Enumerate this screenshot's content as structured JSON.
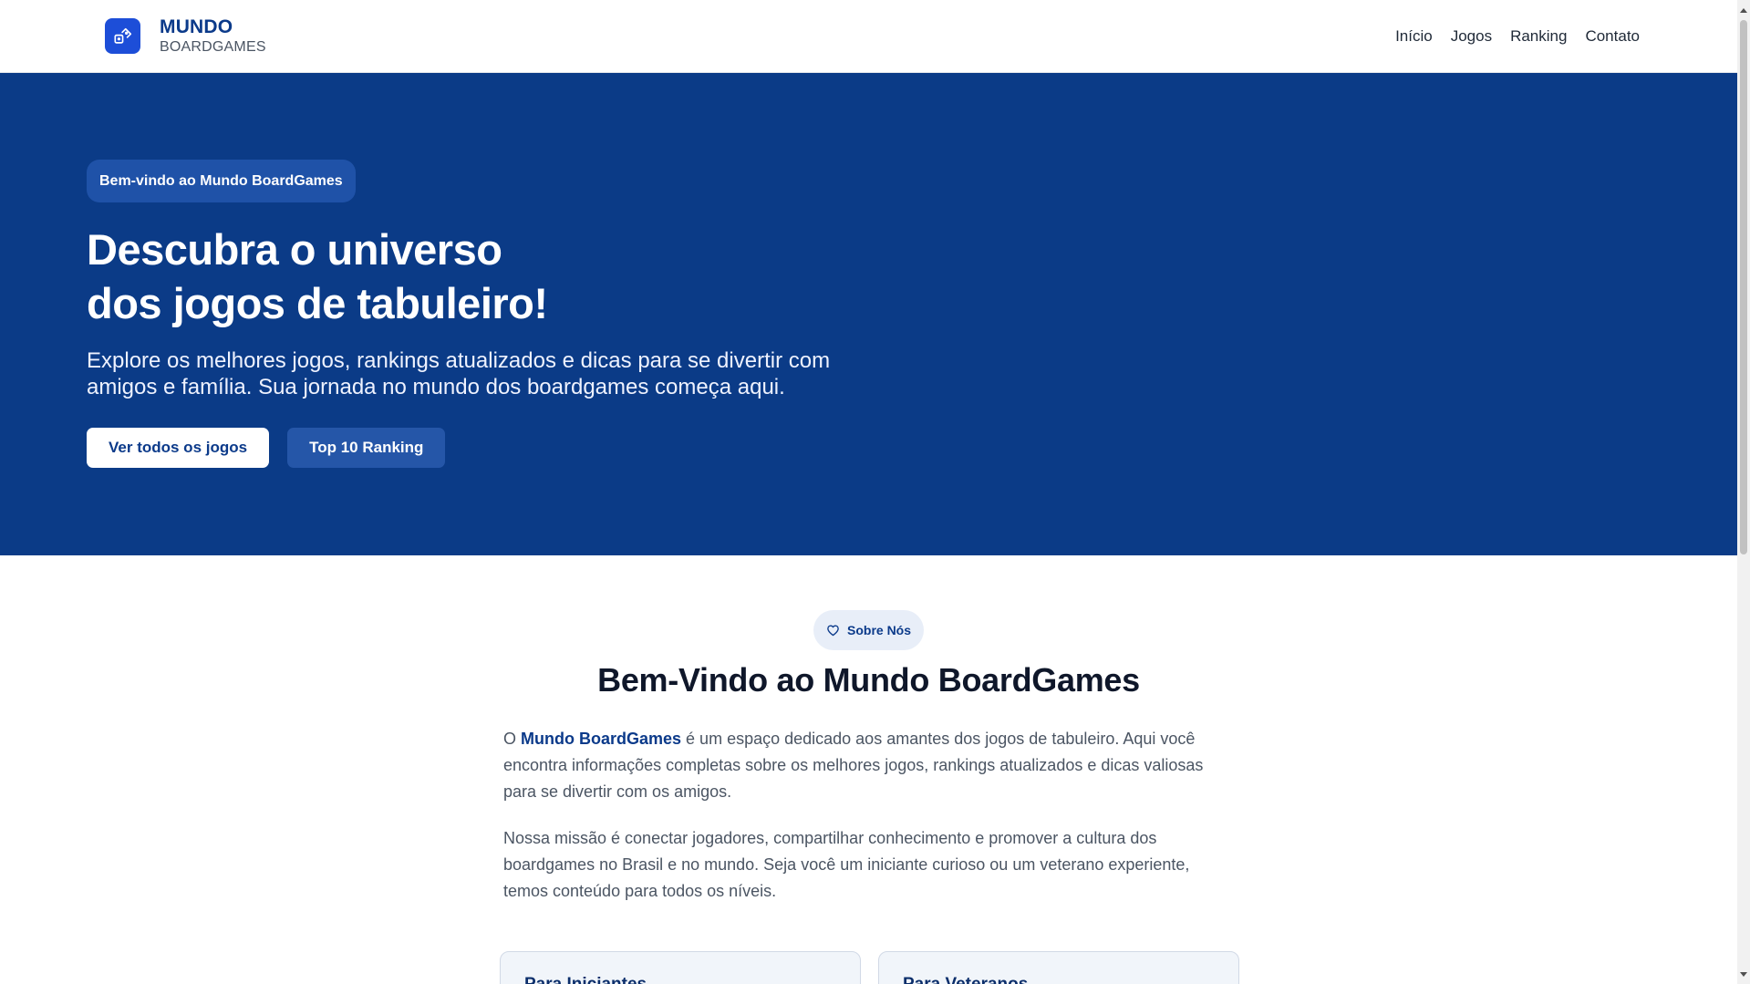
{
  "header": {
    "brand_name": "MUNDO",
    "brand_sub": "BOARDGAMES",
    "nav": [
      {
        "label": "Início"
      },
      {
        "label": "Jogos"
      },
      {
        "label": "Ranking"
      },
      {
        "label": "Contato"
      }
    ]
  },
  "hero": {
    "badge": "Bem-vindo ao Mundo BoardGames",
    "title_line1": "Descubra o universo",
    "title_line2": "dos jogos de tabuleiro!",
    "description": "Explore os melhores jogos, rankings atualizados e dicas para se divertir com amigos e família. Sua jornada no mundo dos boardgames começa aqui.",
    "primary_button": "Ver todos os jogos",
    "secondary_button": "Top 10 Ranking"
  },
  "about": {
    "badge": "Sobre Nós",
    "title": "Bem-Vindo ao Mundo BoardGames",
    "p1_prefix": "O ",
    "p1_highlight": "Mundo BoardGames",
    "p1_rest": " é um espaço dedicado aos amantes dos jogos de tabuleiro. Aqui você encontra informações completas sobre os melhores jogos, rankings atualizados e dicas valiosas para se divertir com os amigos.",
    "p2": "Nossa missão é conectar jogadores, compartilhar conhecimento e promover a cultura dos boardgames no Brasil e no mundo. Seja você um iniciante curioso ou um veterano experiente, temos conteúdo para todos os níveis.",
    "cards": [
      {
        "title": "Para Iniciantes"
      },
      {
        "title": "Para Veteranos"
      }
    ]
  },
  "colors": {
    "brand": "#0b3a8a",
    "hero_bg": "#0b3b87",
    "logo_bg": "#1d4ed8"
  },
  "icons": {
    "logo": "dice-icon",
    "about_badge": "heart-icon"
  }
}
